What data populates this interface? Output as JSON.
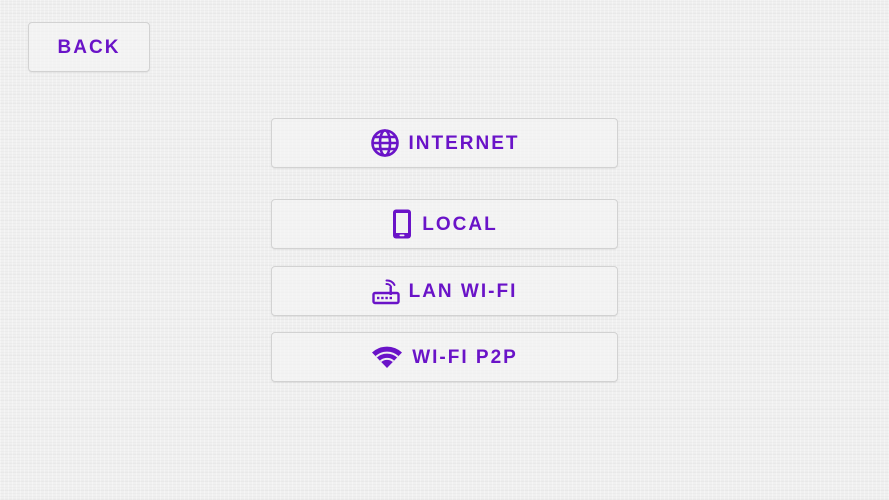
{
  "back_button": {
    "label": "BACK"
  },
  "menu": {
    "items": [
      {
        "label": "INTERNET",
        "icon": "globe-icon"
      },
      {
        "label": "LOCAL",
        "icon": "phone-icon"
      },
      {
        "label": "LAN WI-FI",
        "icon": "router-icon"
      },
      {
        "label": "WI-FI P2P",
        "icon": "wifi-icon"
      }
    ]
  },
  "colors": {
    "accent": "#6a13c8",
    "button_border": "#d2d2d2",
    "background": "#f0f0f0"
  }
}
